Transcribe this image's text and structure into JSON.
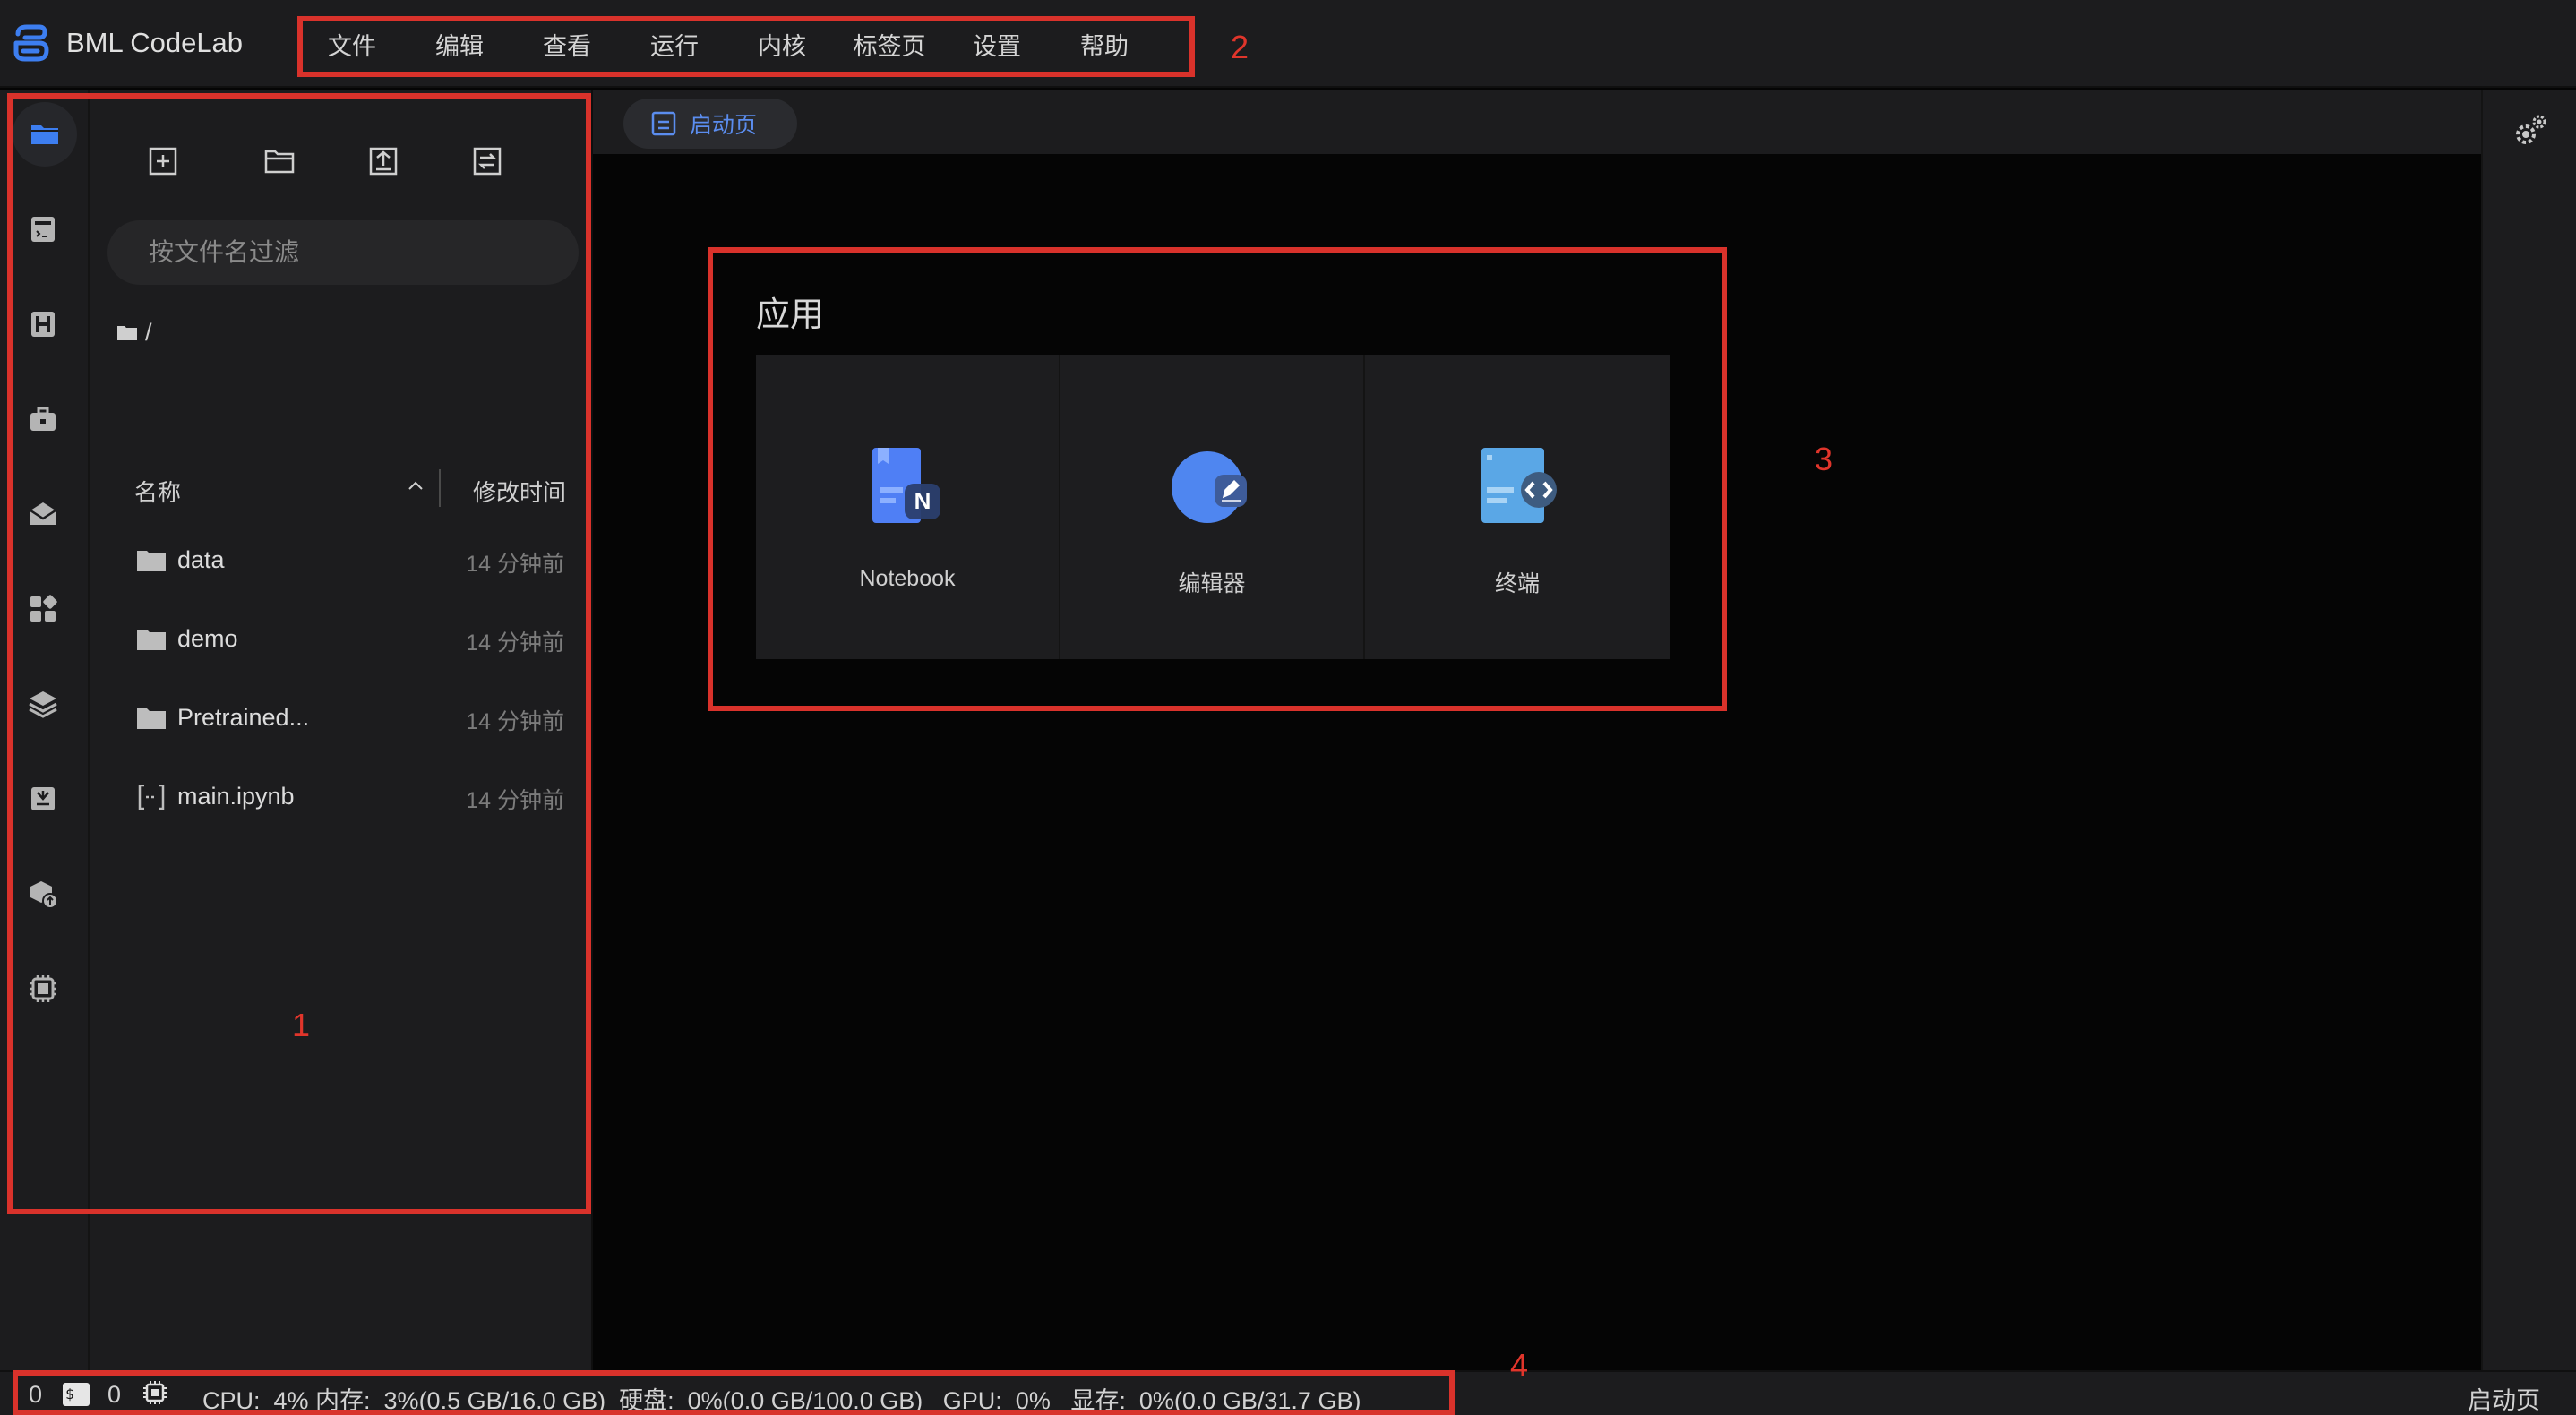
{
  "app": {
    "title": "BML CodeLab"
  },
  "menu": {
    "items": [
      "文件",
      "编辑",
      "查看",
      "运行",
      "内核",
      "标签页",
      "设置",
      "帮助"
    ]
  },
  "activity_bar": {
    "items": [
      "folder-icon",
      "notebook-list-icon",
      "dataset-icon",
      "toolbox-icon",
      "mail-icon",
      "apps-icon",
      "layers-icon",
      "download-icon",
      "package-upload-icon",
      "chip-icon"
    ]
  },
  "file_panel": {
    "toolbar": [
      "new-launcher-icon",
      "new-folder-icon",
      "upload-icon",
      "refresh-icon"
    ],
    "filter_placeholder": "按文件名过滤",
    "breadcrumb": "/",
    "columns": {
      "name": "名称",
      "modified": "修改时间"
    },
    "files": [
      {
        "name": "data",
        "time": "14 分钟前",
        "type": "folder"
      },
      {
        "name": "demo",
        "time": "14 分钟前",
        "type": "folder"
      },
      {
        "name": "Pretrained...",
        "time": "14 分钟前",
        "type": "folder"
      },
      {
        "name": "main.ipynb",
        "time": "14 分钟前",
        "type": "notebook"
      }
    ]
  },
  "tabs": [
    {
      "label": "启动页"
    }
  ],
  "launcher": {
    "section_title": "应用",
    "cards": [
      {
        "label": "Notebook",
        "icon": "notebook-app-icon"
      },
      {
        "label": "编辑器",
        "icon": "editor-app-icon"
      },
      {
        "label": "终端",
        "icon": "terminal-app-icon"
      }
    ]
  },
  "status_bar": {
    "terminals": "0",
    "kernels": "0",
    "metrics": "CPU:  4% 内存:  3%(0.5 GB/16.0 GB)  硬盘:  0%(0.0 GB/100.0 GB)   GPU:  0%   显存:  0%(0.0 GB/31.7 GB)",
    "right_label": "启动页"
  },
  "annotations": {
    "labels": [
      "1",
      "2",
      "3",
      "4"
    ],
    "color": "#d9322b"
  },
  "colors": {
    "accent": "#5b8def",
    "panel": "#1c1c1e",
    "background": "#050505"
  }
}
